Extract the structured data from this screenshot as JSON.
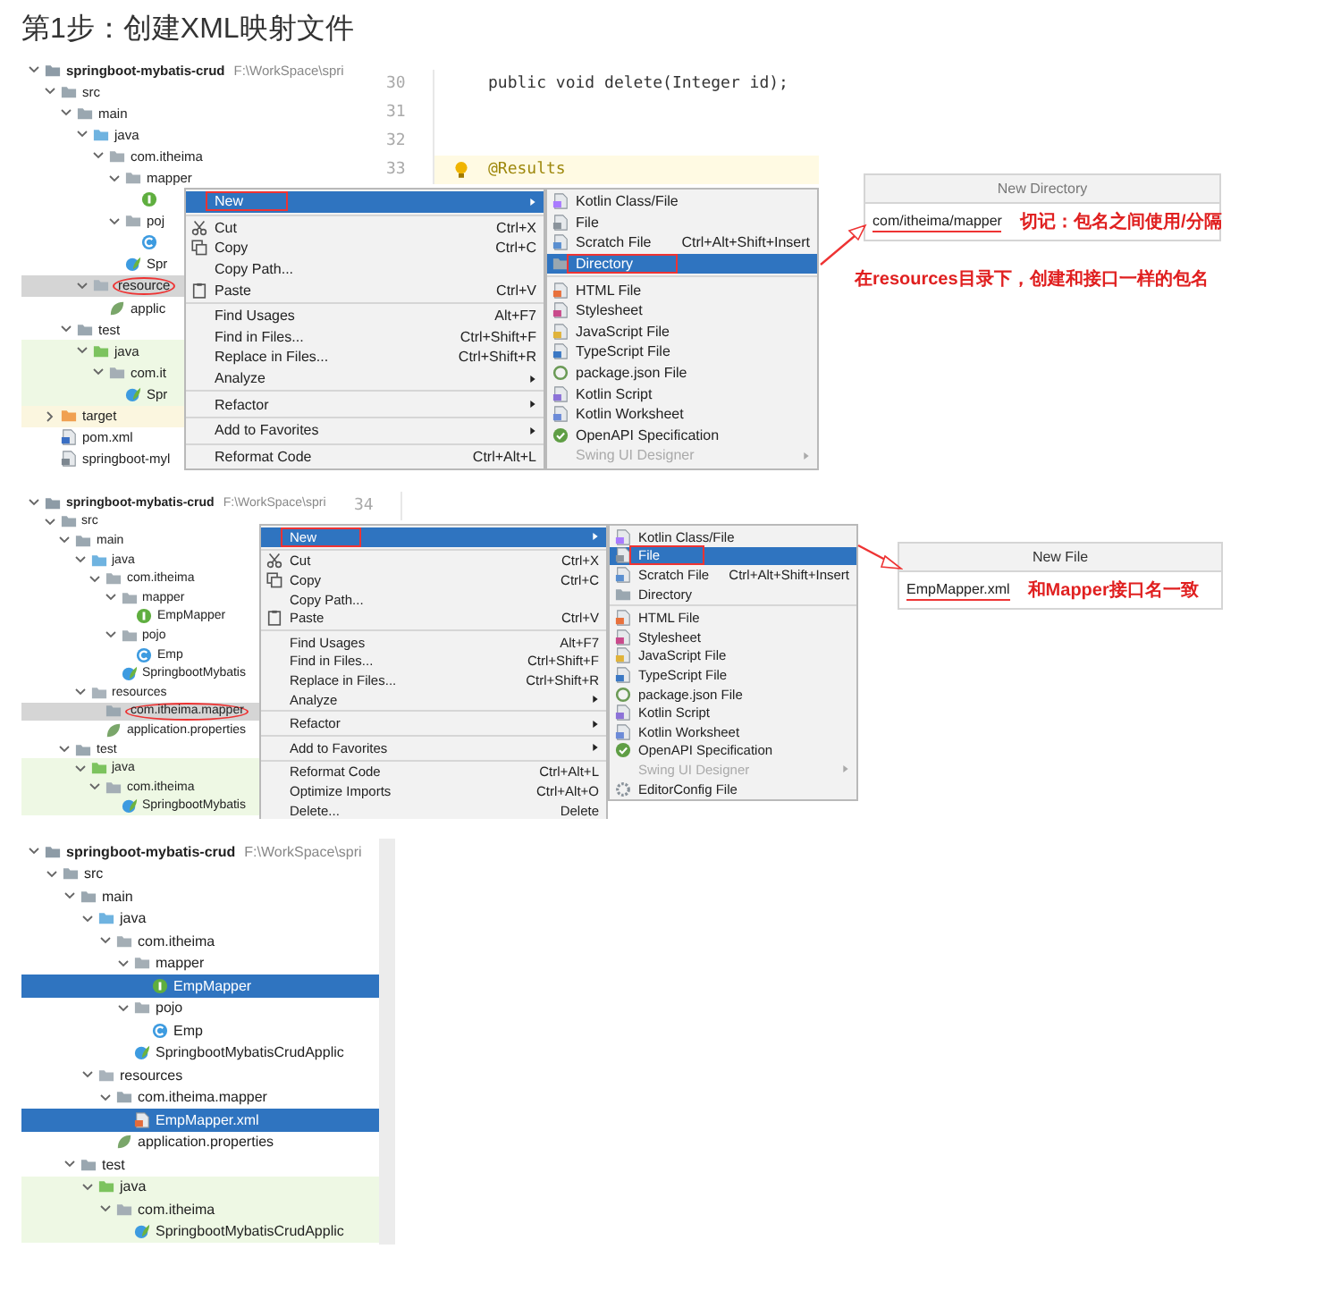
{
  "heading": "第1步：创建XML映射文件",
  "panels": [
    {
      "tree_focused": false,
      "tree": [
        {
          "label": "springboot-mybatis-crud",
          "path": "F:\\WorkSpace\\spri",
          "kind": "module",
          "expanded": true,
          "selected": false,
          "children": [
            {
              "label": "src",
              "kind": "folder",
              "expanded": true,
              "selected": false,
              "children": [
                {
                  "label": "main",
                  "kind": "folder",
                  "expanded": true,
                  "selected": false,
                  "children": [
                    {
                      "label": "java",
                      "kind": "src-folder",
                      "expanded": true,
                      "selected": false,
                      "children": [
                        {
                          "label": "com.itheima",
                          "kind": "package",
                          "expanded": true,
                          "selected": false,
                          "children": [
                            {
                              "label": "mapper",
                              "kind": "package",
                              "expanded": true,
                              "selected": false,
                              "children": [
                                {
                                  "kind": "interface",
                                  "selected": false
                                }
                              ]
                            },
                            {
                              "label": "poj",
                              "kind": "package",
                              "expanded": true,
                              "selected": false,
                              "children": [
                                {
                                  "kind": "class",
                                  "selected": false
                                }
                              ]
                            },
                            {
                              "label": "Spr",
                              "kind": "spring",
                              "selected": false
                            }
                          ]
                        }
                      ]
                    },
                    {
                      "label": "resource",
                      "kind": "res-folder",
                      "expanded": true,
                      "selected": true,
                      "circled": true,
                      "children": [
                        {
                          "label": "applic",
                          "kind": "props",
                          "selected": false
                        }
                      ]
                    }
                  ]
                },
                {
                  "label": "test",
                  "kind": "folder",
                  "expanded": true,
                  "selected": false,
                  "children": [
                    {
                      "label": "java",
                      "kind": "test-folder",
                      "expanded": true,
                      "selected": false,
                      "tinted": true,
                      "children": [
                        {
                          "label": "com.it",
                          "kind": "package",
                          "expanded": true,
                          "selected": false,
                          "tinted": true,
                          "children": [
                            {
                              "label": "Spr",
                              "kind": "spring",
                              "selected": false,
                              "tinted": true
                            }
                          ]
                        }
                      ]
                    }
                  ]
                }
              ]
            },
            {
              "label": "target",
              "kind": "excluded-folder",
              "expanded": false,
              "selected": false,
              "tinted": true
            },
            {
              "label": "pom.xml",
              "kind": "maven",
              "selected": false
            },
            {
              "label": "springboot-myl",
              "kind": "iml",
              "selected": false
            }
          ]
        }
      ],
      "editor": {
        "lines": [
          {
            "number": "30",
            "code": "public void delete(Integer id);",
            "kind": "code",
            "current": false
          },
          {
            "number": "31",
            "current": false
          },
          {
            "number": "32",
            "current": false
          },
          {
            "number": "33",
            "code": "@Results",
            "kind": "annotation",
            "bulb": true,
            "current": true
          }
        ]
      },
      "menu": {
        "groups": [
          [
            {
              "label": "New",
              "arrow": true,
              "selected": true,
              "highlighted": true
            }
          ],
          [
            {
              "label": "Cut",
              "kind": "cut",
              "shortcut": "Ctrl+X",
              "selected": false,
              "highlighted": false
            },
            {
              "label": "Copy",
              "kind": "copy",
              "shortcut": "Ctrl+C",
              "selected": false,
              "highlighted": false
            },
            {
              "label": "Copy Path...",
              "selected": false,
              "highlighted": false
            },
            {
              "label": "Paste",
              "kind": "paste",
              "shortcut": "Ctrl+V",
              "selected": false,
              "highlighted": false
            }
          ],
          [
            {
              "label": "Find Usages",
              "shortcut": "Alt+F7",
              "selected": false,
              "highlighted": false
            },
            {
              "label": "Find in Files...",
              "shortcut": "Ctrl+Shift+F",
              "selected": false,
              "highlighted": false
            },
            {
              "label": "Replace in Files...",
              "shortcut": "Ctrl+Shift+R",
              "selected": false,
              "highlighted": false
            },
            {
              "label": "Analyze",
              "arrow": true,
              "selected": false,
              "highlighted": false
            }
          ],
          [
            {
              "label": "Refactor",
              "arrow": true,
              "selected": false,
              "highlighted": false
            }
          ],
          [
            {
              "label": "Add to Favorites",
              "arrow": true,
              "selected": false,
              "highlighted": false
            }
          ],
          [
            {
              "label": "Reformat Code",
              "shortcut": "Ctrl+Alt+L",
              "selected": false,
              "highlighted": false
            }
          ]
        ]
      },
      "submenu": {
        "groups": [
          [
            {
              "label": "Kotlin Class/File",
              "kind": "kotlin",
              "selected": false,
              "highlighted": false
            },
            {
              "label": "File",
              "kind": "file",
              "selected": false,
              "highlighted": false
            },
            {
              "label": "Scratch File",
              "kind": "scratch",
              "shortcut": "Ctrl+Alt+Shift+Insert",
              "selected": false,
              "highlighted": false
            },
            {
              "label": "Directory",
              "kind": "directory",
              "selected": true,
              "highlighted": true
            }
          ],
          [
            {
              "label": "HTML File",
              "kind": "html",
              "selected": false,
              "highlighted": false
            },
            {
              "label": "Stylesheet",
              "kind": "css",
              "selected": false,
              "highlighted": false
            },
            {
              "label": "JavaScript File",
              "kind": "js",
              "selected": false,
              "highlighted": false
            },
            {
              "label": "TypeScript File",
              "kind": "ts",
              "selected": false,
              "highlighted": false
            },
            {
              "label": "package.json File",
              "kind": "json",
              "selected": false,
              "highlighted": false
            },
            {
              "label": "Kotlin Script",
              "kind": "kotlin-script",
              "selected": false,
              "highlighted": false
            },
            {
              "label": "Kotlin Worksheet",
              "kind": "kotlin-worksheet",
              "selected": false,
              "highlighted": false
            },
            {
              "label": "OpenAPI Specification",
              "kind": "openapi",
              "selected": false,
              "highlighted": false
            },
            {
              "label": "Swing UI Designer",
              "arrow": true,
              "disabled": true,
              "selected": false,
              "highlighted": false
            }
          ]
        ]
      },
      "dialog": {
        "title": "New Directory",
        "value": "com/itheima/mapper",
        "note": "切记：包名之间使用/分隔"
      },
      "caption": "在resources目录下，创建和接口一样的包名"
    },
    {
      "tree_focused": false,
      "tree": [
        {
          "label": "springboot-mybatis-crud",
          "path": "F:\\WorkSpace\\spri",
          "kind": "module",
          "expanded": true,
          "selected": false,
          "children": [
            {
              "label": "src",
              "kind": "folder",
              "expanded": true,
              "selected": false,
              "children": [
                {
                  "label": "main",
                  "kind": "folder",
                  "expanded": true,
                  "selected": false,
                  "children": [
                    {
                      "label": "java",
                      "kind": "src-folder",
                      "expanded": true,
                      "selected": false,
                      "children": [
                        {
                          "label": "com.itheima",
                          "kind": "package",
                          "expanded": true,
                          "selected": false,
                          "children": [
                            {
                              "label": "mapper",
                              "kind": "package",
                              "expanded": true,
                              "selected": false,
                              "children": [
                                {
                                  "label": "EmpMapper",
                                  "kind": "interface",
                                  "selected": false
                                }
                              ]
                            },
                            {
                              "label": "pojo",
                              "kind": "package",
                              "expanded": true,
                              "selected": false,
                              "children": [
                                {
                                  "label": "Emp",
                                  "kind": "class",
                                  "selected": false
                                }
                              ]
                            },
                            {
                              "label": "SpringbootMybatis",
                              "kind": "spring",
                              "selected": false
                            }
                          ]
                        }
                      ]
                    },
                    {
                      "label": "resources",
                      "kind": "res-folder",
                      "expanded": true,
                      "selected": false,
                      "children": [
                        {
                          "label": "com.itheima.mapper",
                          "kind": "folder",
                          "selected": true,
                          "circled": true
                        },
                        {
                          "label": "application.properties",
                          "kind": "props",
                          "selected": false
                        }
                      ]
                    }
                  ]
                },
                {
                  "label": "test",
                  "kind": "folder",
                  "expanded": true,
                  "selected": false,
                  "children": [
                    {
                      "label": "java",
                      "kind": "test-folder",
                      "expanded": true,
                      "selected": false,
                      "tinted": true,
                      "children": [
                        {
                          "label": "com.itheima",
                          "kind": "package",
                          "expanded": true,
                          "selected": false,
                          "tinted": true,
                          "children": [
                            {
                              "label": "SpringbootMybatis",
                              "kind": "spring",
                              "selected": false,
                              "tinted": true
                            }
                          ]
                        }
                      ]
                    }
                  ]
                }
              ]
            }
          ]
        }
      ],
      "editor": {
        "lines": [
          {
            "number": "34",
            "current": false
          }
        ]
      },
      "menu": {
        "groups": [
          [
            {
              "label": "New",
              "arrow": true,
              "selected": true,
              "highlighted": true
            }
          ],
          [
            {
              "label": "Cut",
              "kind": "cut",
              "shortcut": "Ctrl+X",
              "selected": false,
              "highlighted": false
            },
            {
              "label": "Copy",
              "kind": "copy",
              "shortcut": "Ctrl+C",
              "selected": false,
              "highlighted": false
            },
            {
              "label": "Copy Path...",
              "selected": false,
              "highlighted": false
            },
            {
              "label": "Paste",
              "kind": "paste",
              "shortcut": "Ctrl+V",
              "selected": false,
              "highlighted": false
            }
          ],
          [
            {
              "label": "Find Usages",
              "shortcut": "Alt+F7",
              "selected": false,
              "highlighted": false
            },
            {
              "label": "Find in Files...",
              "shortcut": "Ctrl+Shift+F",
              "selected": false,
              "highlighted": false
            },
            {
              "label": "Replace in Files...",
              "shortcut": "Ctrl+Shift+R",
              "selected": false,
              "highlighted": false
            },
            {
              "label": "Analyze",
              "arrow": true,
              "selected": false,
              "highlighted": false
            }
          ],
          [
            {
              "label": "Refactor",
              "arrow": true,
              "selected": false,
              "highlighted": false
            }
          ],
          [
            {
              "label": "Add to Favorites",
              "arrow": true,
              "selected": false,
              "highlighted": false
            }
          ],
          [
            {
              "label": "Reformat Code",
              "shortcut": "Ctrl+Alt+L",
              "selected": false,
              "highlighted": false
            },
            {
              "label": "Optimize Imports",
              "shortcut": "Ctrl+Alt+O",
              "selected": false,
              "highlighted": false
            },
            {
              "label": "Delete...",
              "shortcut": "Delete",
              "selected": false,
              "highlighted": false
            }
          ]
        ]
      },
      "submenu": {
        "groups": [
          [
            {
              "label": "Kotlin Class/File",
              "kind": "kotlin",
              "selected": false,
              "highlighted": false
            },
            {
              "label": "File",
              "kind": "file",
              "selected": true,
              "highlighted": true
            },
            {
              "label": "Scratch File",
              "kind": "scratch",
              "shortcut": "Ctrl+Alt+Shift+Insert",
              "selected": false,
              "highlighted": false
            },
            {
              "label": "Directory",
              "kind": "directory",
              "selected": false,
              "highlighted": false
            }
          ],
          [
            {
              "label": "HTML File",
              "kind": "html",
              "selected": false,
              "highlighted": false
            },
            {
              "label": "Stylesheet",
              "kind": "css",
              "selected": false,
              "highlighted": false
            },
            {
              "label": "JavaScript File",
              "kind": "js",
              "selected": false,
              "highlighted": false
            },
            {
              "label": "TypeScript File",
              "kind": "ts",
              "selected": false,
              "highlighted": false
            },
            {
              "label": "package.json File",
              "kind": "json",
              "selected": false,
              "highlighted": false
            },
            {
              "label": "Kotlin Script",
              "kind": "kotlin-script",
              "selected": false,
              "highlighted": false
            },
            {
              "label": "Kotlin Worksheet",
              "kind": "kotlin-worksheet",
              "selected": false,
              "highlighted": false
            },
            {
              "label": "OpenAPI Specification",
              "kind": "openapi",
              "selected": false,
              "highlighted": false
            },
            {
              "label": "Swing UI Designer",
              "arrow": true,
              "disabled": true,
              "selected": false,
              "highlighted": false
            },
            {
              "label": "EditorConfig File",
              "kind": "editorconfig",
              "selected": false,
              "highlighted": false
            }
          ]
        ]
      },
      "dialog": {
        "title": "New File",
        "value": "EmpMapper.xml",
        "note": "和Mapper接口名一致"
      }
    },
    {
      "tree_focused": true,
      "tree": [
        {
          "label": "springboot-mybatis-crud",
          "path": "F:\\WorkSpace\\spri",
          "kind": "module",
          "expanded": true,
          "selected": false,
          "children": [
            {
              "label": "src",
              "kind": "folder",
              "expanded": true,
              "selected": false,
              "children": [
                {
                  "label": "main",
                  "kind": "folder",
                  "expanded": true,
                  "selected": false,
                  "children": [
                    {
                      "label": "java",
                      "kind": "src-folder",
                      "expanded": true,
                      "selected": false,
                      "children": [
                        {
                          "label": "com.itheima",
                          "kind": "package",
                          "expanded": true,
                          "selected": false,
                          "children": [
                            {
                              "label": "mapper",
                              "kind": "package",
                              "expanded": true,
                              "selected": false,
                              "children": [
                                {
                                  "label": "EmpMapper",
                                  "kind": "interface",
                                  "selected": true
                                }
                              ]
                            },
                            {
                              "label": "pojo",
                              "kind": "package",
                              "expanded": true,
                              "selected": false,
                              "children": [
                                {
                                  "label": "Emp",
                                  "kind": "class",
                                  "selected": false
                                }
                              ]
                            },
                            {
                              "label": "SpringbootMybatisCrudApplic",
                              "kind": "spring",
                              "selected": false
                            }
                          ]
                        }
                      ]
                    },
                    {
                      "label": "resources",
                      "kind": "res-folder",
                      "expanded": true,
                      "selected": false,
                      "children": [
                        {
                          "label": "com.itheima.mapper",
                          "kind": "folder",
                          "expanded": true,
                          "selected": false,
                          "children": [
                            {
                              "label": "EmpMapper.xml",
                              "kind": "xml",
                              "selected": true
                            }
                          ]
                        },
                        {
                          "label": "application.properties",
                          "kind": "props",
                          "selected": false
                        }
                      ]
                    }
                  ]
                },
                {
                  "label": "test",
                  "kind": "folder",
                  "expanded": true,
                  "selected": false,
                  "children": [
                    {
                      "label": "java",
                      "kind": "test-folder",
                      "expanded": true,
                      "selected": false,
                      "tinted": true,
                      "children": [
                        {
                          "label": "com.itheima",
                          "kind": "package",
                          "expanded": true,
                          "selected": false,
                          "tinted": true,
                          "children": [
                            {
                              "label": "SpringbootMybatisCrudApplic",
                              "kind": "spring",
                              "selected": false,
                              "tinted": true
                            }
                          ]
                        }
                      ]
                    }
                  ]
                }
              ]
            }
          ]
        }
      ]
    }
  ]
}
